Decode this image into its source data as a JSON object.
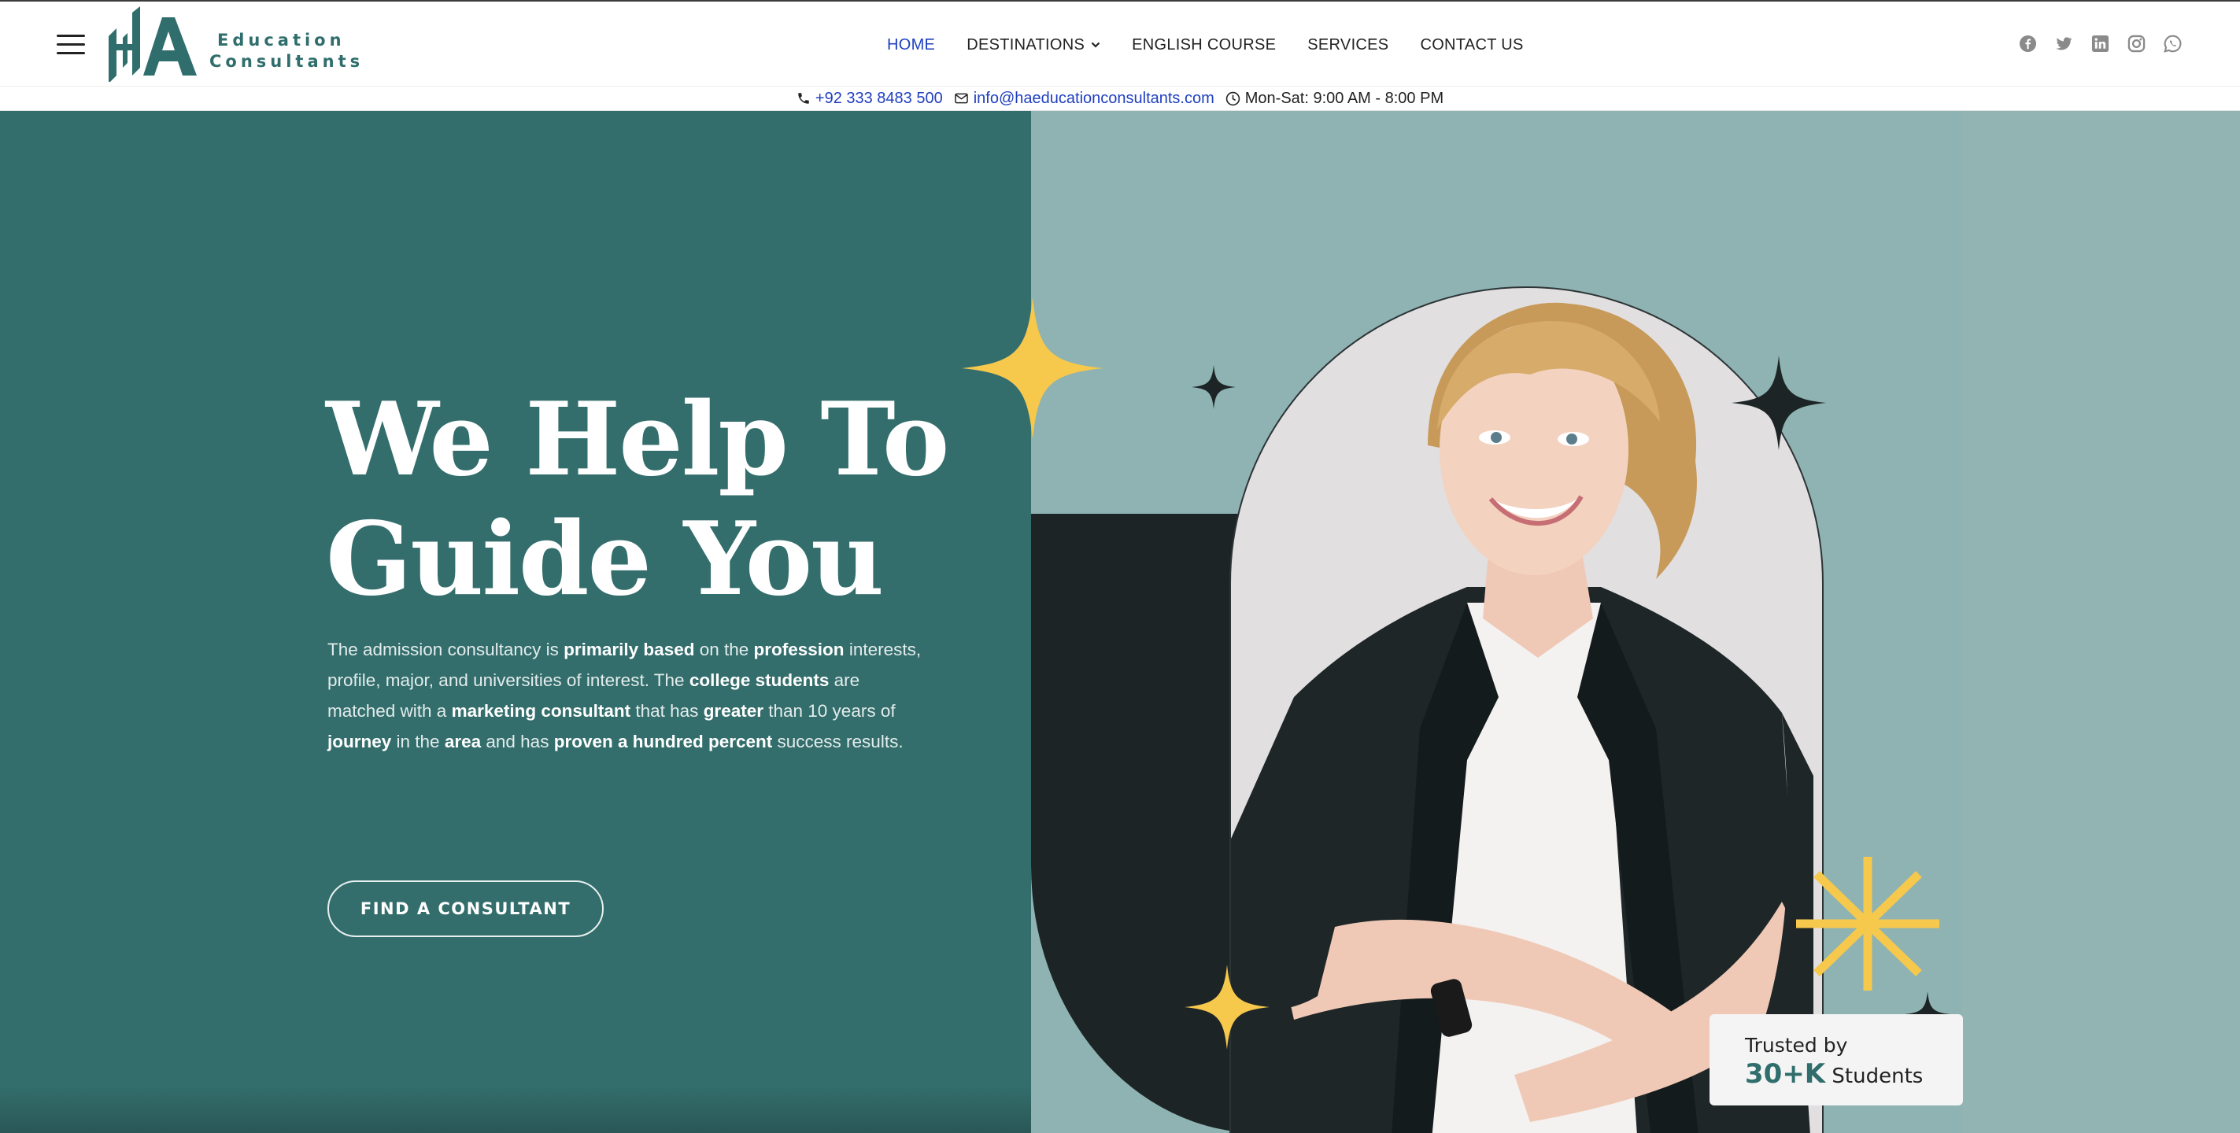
{
  "brand": {
    "name_line1": "Education",
    "name_line2": "Consultants",
    "logo_icon": "ha-monogram-logo",
    "accent": "#336e6c",
    "link_color": "#1f3fbf",
    "star_color": "#f6c84c"
  },
  "nav": {
    "items": [
      {
        "label": "HOME",
        "active": true
      },
      {
        "label": "DESTINATIONS",
        "has_dropdown": true
      },
      {
        "label": "ENGLISH COURSE"
      },
      {
        "label": "SERVICES"
      },
      {
        "label": "CONTACT US"
      }
    ]
  },
  "socials": [
    "facebook-icon",
    "twitter-icon",
    "linkedin-icon",
    "instagram-icon",
    "whatsapp-icon"
  ],
  "infobar": {
    "phone": "+92 333 8483 500",
    "email": "info@haeducationconsultants.com",
    "hours": "Mon-Sat: 9:00 AM - 8:00 PM"
  },
  "hero": {
    "title_line1": "We Help To",
    "title_line2": "Guide You",
    "description": [
      {
        "t": "The admission consultancy is "
      },
      {
        "t": "primarily based",
        "b": true
      },
      {
        "t": " on the "
      },
      {
        "t": "profession",
        "b": true
      },
      {
        "t": " interests, profile, major, and universities of interest. The "
      },
      {
        "t": "college students",
        "b": true
      },
      {
        "t": " are matched with a "
      },
      {
        "t": "marketing consultant",
        "b": true
      },
      {
        "t": " that has "
      },
      {
        "t": "greater",
        "b": true
      },
      {
        "t": " than 10 years of "
      },
      {
        "t": "journey",
        "b": true
      },
      {
        "t": " in the "
      },
      {
        "t": "area",
        "b": true
      },
      {
        "t": " and has "
      },
      {
        "t": "proven a hundred percent",
        "b": true
      },
      {
        "t": " success results."
      }
    ],
    "cta_label": "FIND A CONSULTANT"
  },
  "trust_card": {
    "line1": "Trusted by",
    "count": "30+K",
    "suffix": "Students"
  }
}
